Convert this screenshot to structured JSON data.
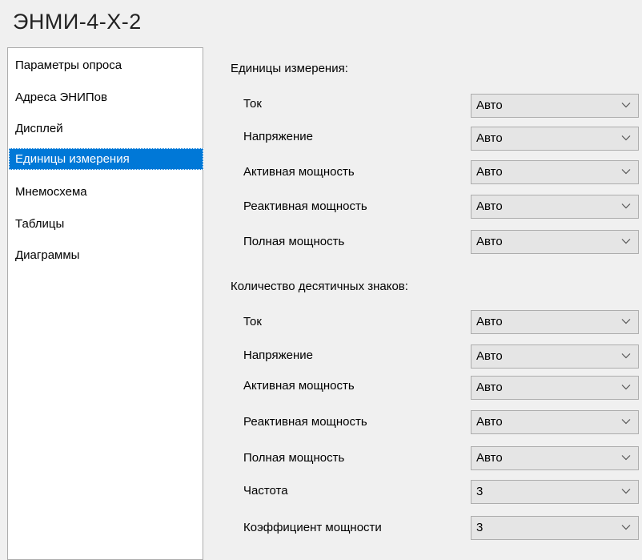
{
  "window": {
    "title": "ЭНМИ-4-Х-2"
  },
  "sidebar": {
    "items": [
      {
        "label": "Параметры опроса",
        "selected": false
      },
      {
        "label": "Адреса ЭНИПов",
        "selected": false
      },
      {
        "label": "Дисплей",
        "selected": false
      },
      {
        "label": "Единицы измерения",
        "selected": true
      },
      {
        "label": "Мнемосхема",
        "selected": false
      },
      {
        "label": "Таблицы",
        "selected": false
      },
      {
        "label": "Диаграммы",
        "selected": false
      }
    ]
  },
  "units_section": {
    "header": "Единицы измерения:",
    "fields": [
      {
        "label": "Ток",
        "value": "Авто"
      },
      {
        "label": "Напряжение",
        "value": "Авто"
      },
      {
        "label": "Активная мощность",
        "value": "Авто"
      },
      {
        "label": "Реактивная мощность",
        "value": "Авто"
      },
      {
        "label": "Полная мощность",
        "value": "Авто"
      }
    ]
  },
  "decimals_section": {
    "header": "Количество десятичных знаков:",
    "fields": [
      {
        "label": "Ток",
        "value": "Авто"
      },
      {
        "label": "Напряжение",
        "value": "Авто"
      },
      {
        "label": "Активная мощность",
        "value": "Авто"
      },
      {
        "label": "Реактивная мощность",
        "value": "Авто"
      },
      {
        "label": "Полная мощность",
        "value": "Авто"
      },
      {
        "label": "Частота",
        "value": "3"
      },
      {
        "label": "Коэффициент мощности",
        "value": "3"
      }
    ]
  },
  "colors": {
    "selection": "#0078d7",
    "combo_background": "#e5e5e5",
    "window_background": "#f0f0f0"
  },
  "icons": {
    "dropdown": "chevron-down-icon"
  }
}
